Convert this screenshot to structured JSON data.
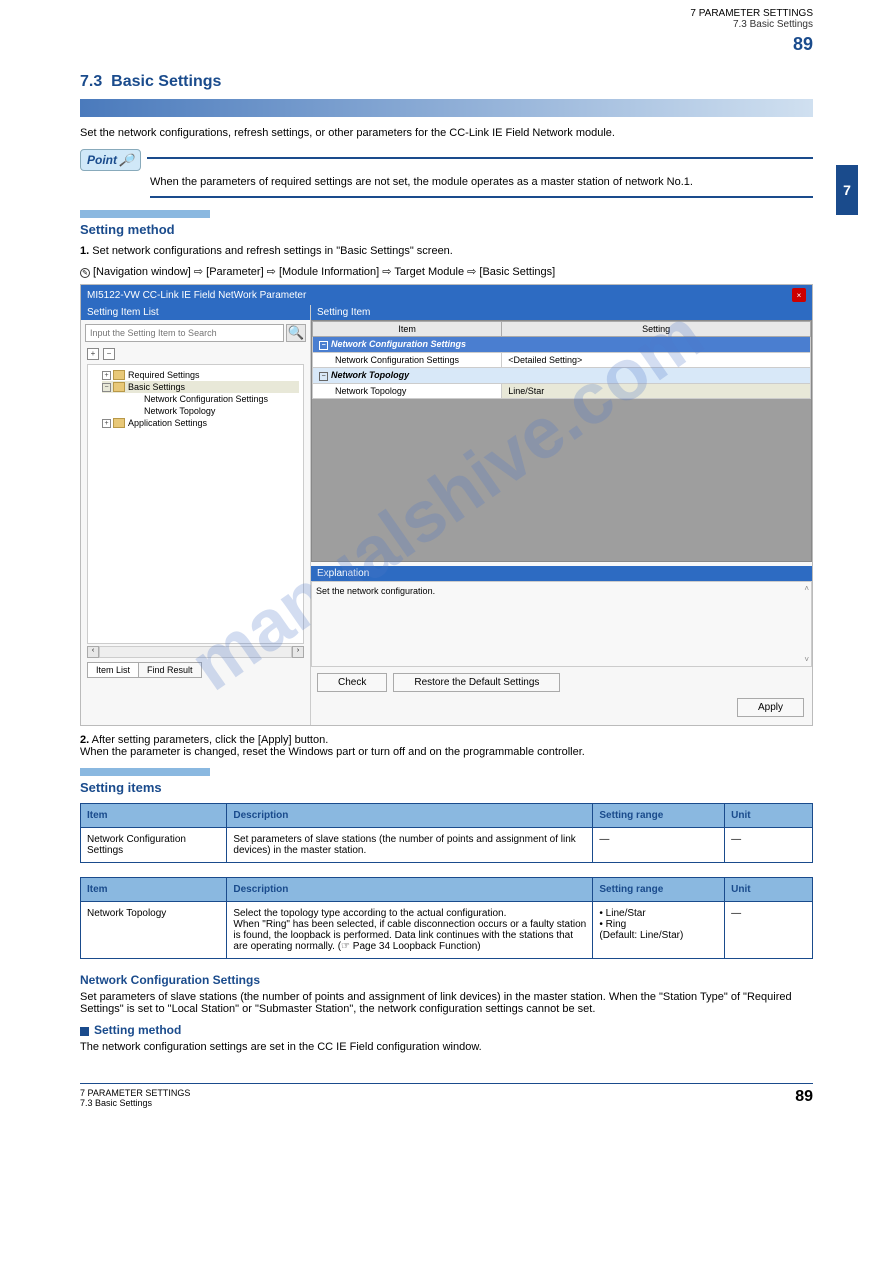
{
  "page": {
    "top_right_chapter": "7  PARAMETER SETTINGS",
    "top_right_sub": "7.3  Basic Settings",
    "top_right_num": "89",
    "side_tab": "7",
    "footer_left": "7  PARAMETER SETTINGS",
    "footer_sub": "7.3  Basic Settings",
    "footer_num": "89"
  },
  "watermark": "manualshive.com",
  "section": {
    "number": "7.3",
    "title": "Basic Settings",
    "intro": "Set the network configurations, refresh settings, or other parameters for the CC-Link IE Field Network module."
  },
  "point": {
    "label": "Point",
    "body": "When the parameters of required settings are not set, the module operates as a master station of network No.1."
  },
  "setting_method": {
    "bar_title": "Setting method",
    "list_item1": "1.",
    "list_item1_text": "Set network configurations and refresh settings in \"Basic Settings\" screen.",
    "nav": "[Navigation window] ⇨ [Parameter] ⇨ [Module Information] ⇨ Target Module ⇨ [Basic Settings]",
    "list_item2": "2.",
    "list_item2_text_a": "After setting parameters, click the [Apply] button.",
    "list_item2_text_b": "When the parameter is changed, reset the Windows part or turn off and on the programmable controller."
  },
  "screenshot": {
    "title": "MI5122-VW CC-Link IE Field NetWork Parameter",
    "left_panel_title": "Setting Item List",
    "search_placeholder": "Input the Setting Item to Search",
    "tree": {
      "root1": "Required Settings",
      "root2": "Basic Settings",
      "child2a": "Network Configuration Settings",
      "child2b": "Network Topology",
      "root3": "Application Settings"
    },
    "tabs": {
      "t1": "Item List",
      "t2": "Find Result"
    },
    "right_panel_title": "Setting Item",
    "grid": {
      "col1": "Item",
      "col2": "Setting",
      "r1": "Network Configuration Settings",
      "r1a_item": "Network Configuration Settings",
      "r1a_val": "<Detailed Setting>",
      "r2": "Network Topology",
      "r2a_item": "Network Topology",
      "r2a_val": "Line/Star"
    },
    "explanation_title": "Explanation",
    "explanation_text": "Set the network configuration.",
    "btn_check": "Check",
    "btn_restore": "Restore the Default Settings",
    "btn_apply": "Apply"
  },
  "setting_items": {
    "bar_title": "Setting items",
    "table1": {
      "h1": "Item",
      "h2": "Description",
      "h3": "Setting range",
      "h4": "Unit",
      "r1c1": "Network Configuration Settings",
      "r1c2": "Set parameters of slave stations (the number of points and assignment of link devices) in the master station.",
      "r1c3": "—",
      "r1c4": "—"
    },
    "net_conf_title": "Network Configuration Settings",
    "net_conf_intro": "Set parameters of slave stations (the number of points and assignment of link devices) in the master station. When the \"Station Type\" of \"Required Settings\" is set to \"Local Station\" or \"Submaster Station\", the network configuration settings cannot be set.",
    "sub_title": "Setting method",
    "sub_text": "The network configuration settings are set in the CC IE Field configuration window.",
    "table2": {
      "h1": "Item",
      "h2": "Description",
      "h3": "Setting range",
      "h4": "Unit",
      "r1c1": "Network Topology",
      "r1c2": "Select the topology type according to the actual configuration.\nWhen \"Ring\" has been selected, if cable disconnection occurs or a faulty station is found, the loopback is performed. Data link continues with the stations that are operating normally. (☞ Page 34 Loopback Function)",
      "r1c3": "• Line/Star\n• Ring\n(Default: Line/Star)",
      "r1c4": "—"
    }
  }
}
